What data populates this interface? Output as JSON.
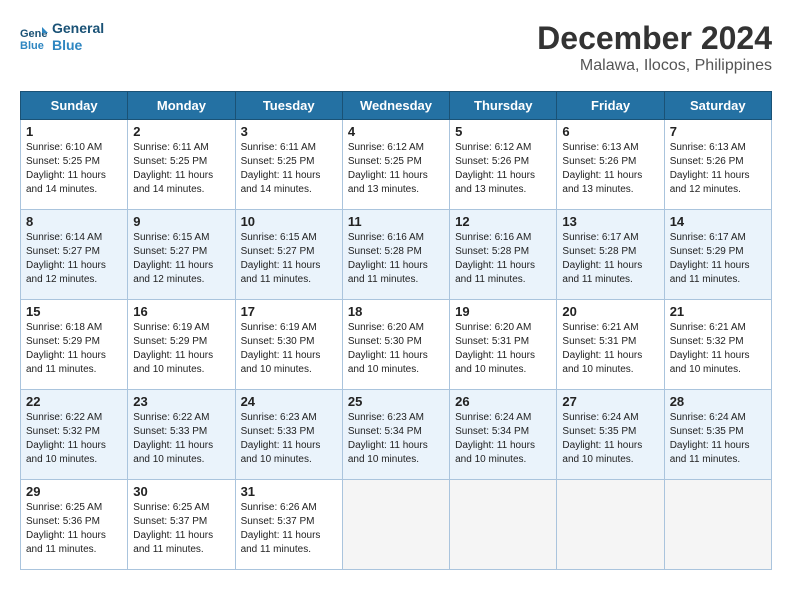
{
  "logo": {
    "line1": "General",
    "line2": "Blue"
  },
  "title": "December 2024",
  "location": "Malawa, Ilocos, Philippines",
  "days_of_week": [
    "Sunday",
    "Monday",
    "Tuesday",
    "Wednesday",
    "Thursday",
    "Friday",
    "Saturday"
  ],
  "weeks": [
    [
      {
        "day": "1",
        "info": "Sunrise: 6:10 AM\nSunset: 5:25 PM\nDaylight: 11 hours\nand 14 minutes."
      },
      {
        "day": "2",
        "info": "Sunrise: 6:11 AM\nSunset: 5:25 PM\nDaylight: 11 hours\nand 14 minutes."
      },
      {
        "day": "3",
        "info": "Sunrise: 6:11 AM\nSunset: 5:25 PM\nDaylight: 11 hours\nand 14 minutes."
      },
      {
        "day": "4",
        "info": "Sunrise: 6:12 AM\nSunset: 5:25 PM\nDaylight: 11 hours\nand 13 minutes."
      },
      {
        "day": "5",
        "info": "Sunrise: 6:12 AM\nSunset: 5:26 PM\nDaylight: 11 hours\nand 13 minutes."
      },
      {
        "day": "6",
        "info": "Sunrise: 6:13 AM\nSunset: 5:26 PM\nDaylight: 11 hours\nand 13 minutes."
      },
      {
        "day": "7",
        "info": "Sunrise: 6:13 AM\nSunset: 5:26 PM\nDaylight: 11 hours\nand 12 minutes."
      }
    ],
    [
      {
        "day": "8",
        "info": "Sunrise: 6:14 AM\nSunset: 5:27 PM\nDaylight: 11 hours\nand 12 minutes."
      },
      {
        "day": "9",
        "info": "Sunrise: 6:15 AM\nSunset: 5:27 PM\nDaylight: 11 hours\nand 12 minutes."
      },
      {
        "day": "10",
        "info": "Sunrise: 6:15 AM\nSunset: 5:27 PM\nDaylight: 11 hours\nand 11 minutes."
      },
      {
        "day": "11",
        "info": "Sunrise: 6:16 AM\nSunset: 5:28 PM\nDaylight: 11 hours\nand 11 minutes."
      },
      {
        "day": "12",
        "info": "Sunrise: 6:16 AM\nSunset: 5:28 PM\nDaylight: 11 hours\nand 11 minutes."
      },
      {
        "day": "13",
        "info": "Sunrise: 6:17 AM\nSunset: 5:28 PM\nDaylight: 11 hours\nand 11 minutes."
      },
      {
        "day": "14",
        "info": "Sunrise: 6:17 AM\nSunset: 5:29 PM\nDaylight: 11 hours\nand 11 minutes."
      }
    ],
    [
      {
        "day": "15",
        "info": "Sunrise: 6:18 AM\nSunset: 5:29 PM\nDaylight: 11 hours\nand 11 minutes."
      },
      {
        "day": "16",
        "info": "Sunrise: 6:19 AM\nSunset: 5:29 PM\nDaylight: 11 hours\nand 10 minutes."
      },
      {
        "day": "17",
        "info": "Sunrise: 6:19 AM\nSunset: 5:30 PM\nDaylight: 11 hours\nand 10 minutes."
      },
      {
        "day": "18",
        "info": "Sunrise: 6:20 AM\nSunset: 5:30 PM\nDaylight: 11 hours\nand 10 minutes."
      },
      {
        "day": "19",
        "info": "Sunrise: 6:20 AM\nSunset: 5:31 PM\nDaylight: 11 hours\nand 10 minutes."
      },
      {
        "day": "20",
        "info": "Sunrise: 6:21 AM\nSunset: 5:31 PM\nDaylight: 11 hours\nand 10 minutes."
      },
      {
        "day": "21",
        "info": "Sunrise: 6:21 AM\nSunset: 5:32 PM\nDaylight: 11 hours\nand 10 minutes."
      }
    ],
    [
      {
        "day": "22",
        "info": "Sunrise: 6:22 AM\nSunset: 5:32 PM\nDaylight: 11 hours\nand 10 minutes."
      },
      {
        "day": "23",
        "info": "Sunrise: 6:22 AM\nSunset: 5:33 PM\nDaylight: 11 hours\nand 10 minutes."
      },
      {
        "day": "24",
        "info": "Sunrise: 6:23 AM\nSunset: 5:33 PM\nDaylight: 11 hours\nand 10 minutes."
      },
      {
        "day": "25",
        "info": "Sunrise: 6:23 AM\nSunset: 5:34 PM\nDaylight: 11 hours\nand 10 minutes."
      },
      {
        "day": "26",
        "info": "Sunrise: 6:24 AM\nSunset: 5:34 PM\nDaylight: 11 hours\nand 10 minutes."
      },
      {
        "day": "27",
        "info": "Sunrise: 6:24 AM\nSunset: 5:35 PM\nDaylight: 11 hours\nand 10 minutes."
      },
      {
        "day": "28",
        "info": "Sunrise: 6:24 AM\nSunset: 5:35 PM\nDaylight: 11 hours\nand 11 minutes."
      }
    ],
    [
      {
        "day": "29",
        "info": "Sunrise: 6:25 AM\nSunset: 5:36 PM\nDaylight: 11 hours\nand 11 minutes."
      },
      {
        "day": "30",
        "info": "Sunrise: 6:25 AM\nSunset: 5:37 PM\nDaylight: 11 hours\nand 11 minutes."
      },
      {
        "day": "31",
        "info": "Sunrise: 6:26 AM\nSunset: 5:37 PM\nDaylight: 11 hours\nand 11 minutes."
      },
      {
        "day": "",
        "info": ""
      },
      {
        "day": "",
        "info": ""
      },
      {
        "day": "",
        "info": ""
      },
      {
        "day": "",
        "info": ""
      }
    ]
  ]
}
